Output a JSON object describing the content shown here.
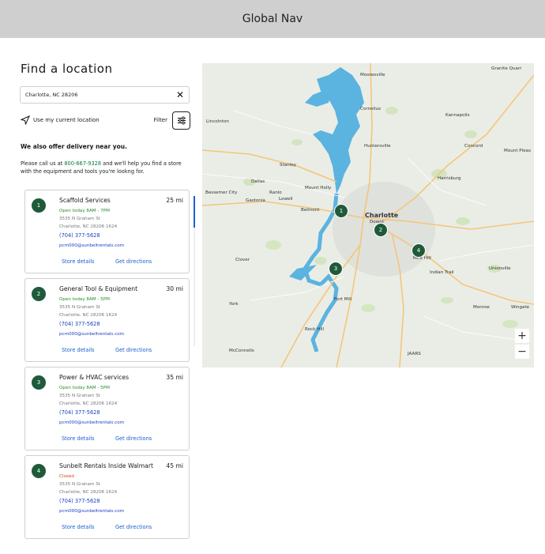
{
  "global_nav": {
    "label": "Global Nav"
  },
  "panel": {
    "title": "Find a location",
    "search": {
      "value": "Charlotte, NC 28206",
      "placeholder": ""
    },
    "use_location_label": "Use my current location",
    "filter_label": "Filter",
    "delivery_heading": "We also offer delivery near you.",
    "delivery_text_before": "Please call us at ",
    "delivery_phone": "800-667-9328",
    "delivery_text_after": " and we'll help you find a store with the equipment and tools you're lookng for."
  },
  "stores": [
    {
      "number": "1",
      "name": "Scaffold Services",
      "distance": "25 mi",
      "hours": "Open today 8AM - 7PM",
      "closed": false,
      "address1": "3535 N Graham St",
      "address2": "Charlotte, NC    28206 1624",
      "phone": "(704) 377-5628",
      "email": "pcm000@sunbeltrentals.com",
      "details_label": "Store details",
      "directions_label": "Get directions"
    },
    {
      "number": "2",
      "name": "General Tool & Equipment",
      "distance": "30 mi",
      "hours": "Open today 8AM - 5PM",
      "closed": false,
      "address1": "3535 N Graham St",
      "address2": "Charlotte, NC    28206 1624",
      "phone": "(704) 377-5628",
      "email": "pcm000@sunbeltrentals.com",
      "details_label": "Store details",
      "directions_label": "Get directions"
    },
    {
      "number": "3",
      "name": "Power & HVAC services",
      "distance": "35 mi",
      "hours": "Open today 8AM - 5PM",
      "closed": false,
      "address1": "3535 N Graham St",
      "address2": "Charlotte, NC    28206 1624",
      "phone": "(704) 377-5628",
      "email": "pcm000@sunbeltrentals.com",
      "details_label": "Store details",
      "directions_label": "Get directions"
    },
    {
      "number": "4",
      "name": "Sunbelt Rentals Inside Walmart",
      "distance": "45 mi",
      "hours": "Closed",
      "closed": true,
      "address1": "3535 N Graham St",
      "address2": "Charlotte, NC    28206 1624",
      "phone": "(704) 377-5628",
      "email": "pcm000@sunbeltrentals.com",
      "details_label": "Store details",
      "directions_label": "Get directions"
    }
  ],
  "map": {
    "zoom_in": "+",
    "zoom_out": "−",
    "places": {
      "charlotte": "Charlotte",
      "mooresville": "Mooresville",
      "cornelius": "Cornelius",
      "kannapolis": "Kannapolis",
      "huntersville": "Huntersville",
      "concord": "Concord",
      "mount_pleasant": "Mount Pleas",
      "lincolnton": "Lincolnton",
      "stanley": "Stanley",
      "harrisburg": "Harrisburg",
      "dallas": "Dallas",
      "mount_holly": "Mount Holly",
      "bessemer_city": "Bessemer City",
      "ranlo": "Ranlo",
      "gastonia": "Gastonia",
      "lowell": "Lowell",
      "belmont": "Belmont",
      "clover": "Clover",
      "mint_hill": "Mint Hill",
      "indian_trail": "Indian Trail",
      "unionville": "Unionville",
      "fort_mill": "Fort Mill",
      "york": "York",
      "monroe": "Monroe",
      "wingate": "Wingate",
      "rock_hill": "Rock Hill",
      "mcconnells": "McConnells",
      "jaars": "JAARS",
      "granite_quarry": "Granite Quarr",
      "downtown": "Downt"
    },
    "pins": [
      "1",
      "2",
      "3",
      "4"
    ]
  }
}
